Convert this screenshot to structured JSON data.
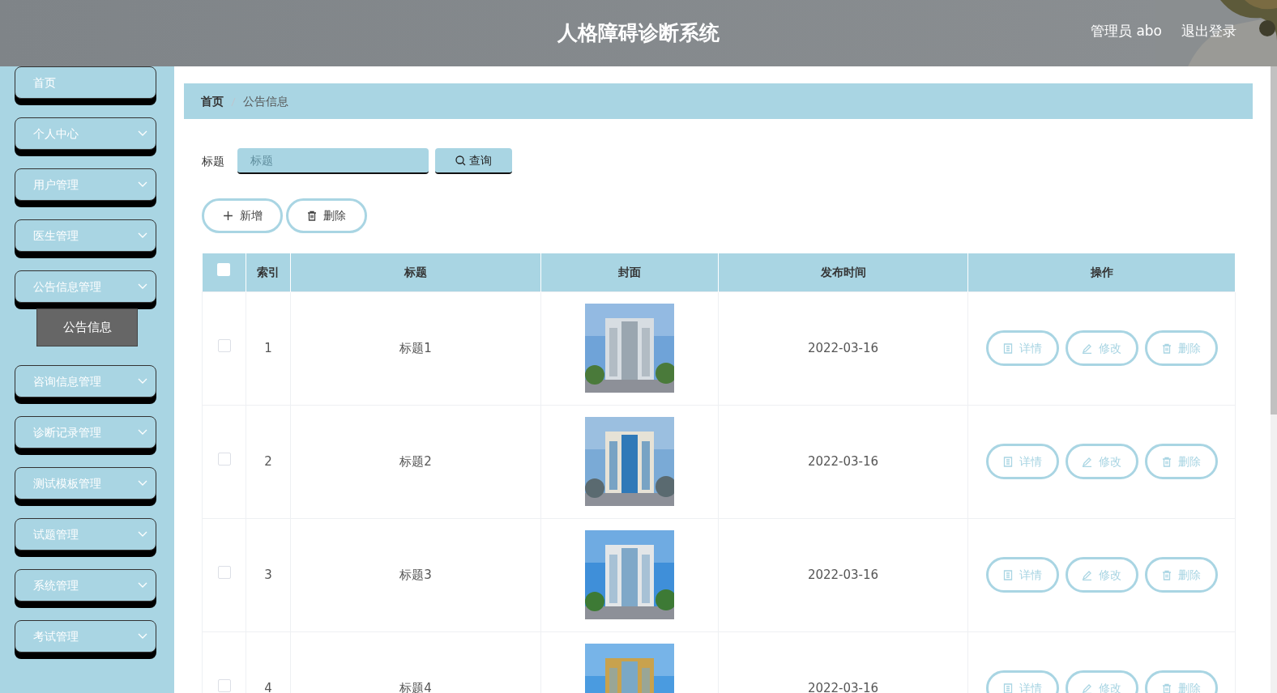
{
  "header": {
    "title": "人格障碍诊断系统",
    "user": "管理员 abo",
    "logout": "退出登录"
  },
  "sidebar": {
    "items": [
      {
        "label": "首页",
        "kind": "link"
      },
      {
        "label": "个人中心",
        "kind": "menu"
      },
      {
        "label": "用户管理",
        "kind": "menu"
      },
      {
        "label": "医生管理",
        "kind": "menu"
      },
      {
        "label": "公告信息管理",
        "kind": "menu",
        "children": [
          {
            "label": "公告信息",
            "selected": true
          }
        ]
      },
      {
        "label": "咨询信息管理",
        "kind": "menu"
      },
      {
        "label": "诊断记录管理",
        "kind": "menu"
      },
      {
        "label": "测试模板管理",
        "kind": "menu"
      },
      {
        "label": "试题管理",
        "kind": "menu"
      },
      {
        "label": "系统管理",
        "kind": "menu"
      },
      {
        "label": "考试管理",
        "kind": "menu"
      }
    ]
  },
  "breadcrumb": [
    "首页",
    "公告信息"
  ],
  "search": {
    "label": "标题",
    "placeholder": "标题",
    "button": "查询"
  },
  "actions": [
    {
      "kind": "add",
      "label": "新增"
    },
    {
      "kind": "delete",
      "label": "删除"
    }
  ],
  "table": {
    "select_all_checked": false,
    "columns": [
      "索引",
      "标题",
      "封面",
      "发布时间",
      "操作"
    ],
    "rows": [
      {
        "checked": false,
        "index": "1",
        "title": "标题1",
        "date": "2022-03-16",
        "actions": [
          {
            "kind": "detail",
            "label": "详情"
          },
          {
            "kind": "edit",
            "label": "修改"
          },
          {
            "kind": "delete",
            "label": "删除"
          }
        ]
      },
      {
        "checked": false,
        "index": "2",
        "title": "标题2",
        "date": "2022-03-16",
        "actions": [
          {
            "kind": "detail",
            "label": "详情"
          },
          {
            "kind": "edit",
            "label": "修改"
          },
          {
            "kind": "delete",
            "label": "删除"
          }
        ]
      },
      {
        "checked": false,
        "index": "3",
        "title": "标题3",
        "date": "2022-03-16",
        "actions": [
          {
            "kind": "detail",
            "label": "详情"
          },
          {
            "kind": "edit",
            "label": "修改"
          },
          {
            "kind": "delete",
            "label": "删除"
          }
        ]
      },
      {
        "checked": false,
        "index": "4",
        "title": "标题4",
        "date": "2022-03-16",
        "actions": [
          {
            "kind": "detail",
            "label": "详情"
          },
          {
            "kind": "edit",
            "label": "修改"
          },
          {
            "kind": "delete",
            "label": "删除"
          }
        ]
      }
    ]
  }
}
